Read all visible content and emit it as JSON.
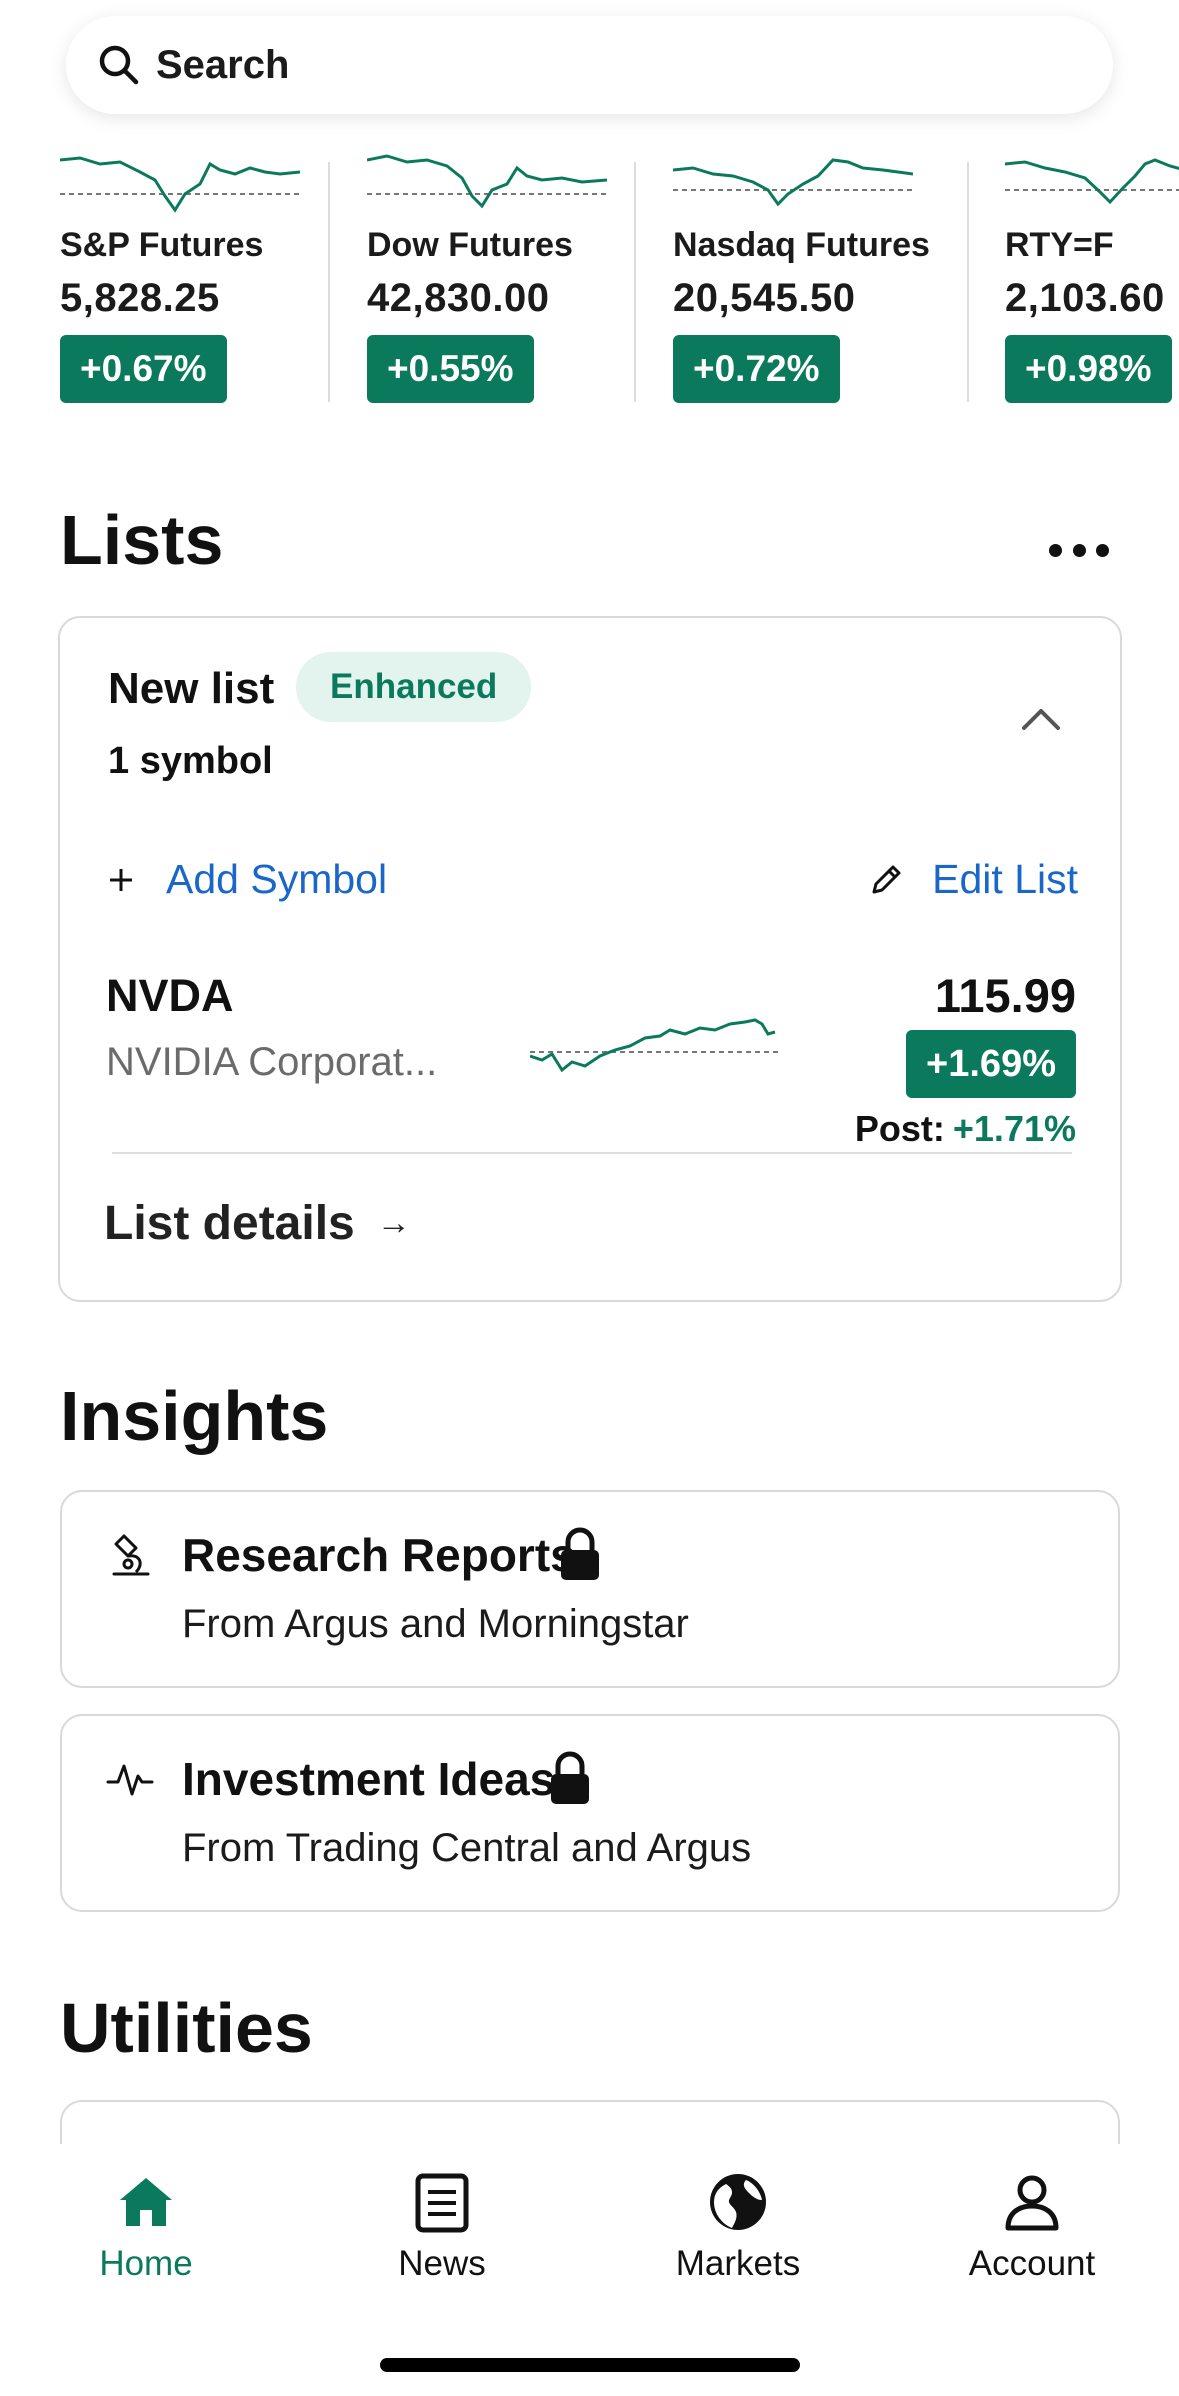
{
  "search": {
    "placeholder": "Search",
    "icon": "search-icon"
  },
  "tickers": [
    {
      "name": "S&P Futures",
      "price": "5,828.25",
      "change": "+0.67%"
    },
    {
      "name": "Dow Futures",
      "price": "42,830.00",
      "change": "+0.55%"
    },
    {
      "name": "Nasdaq Futures",
      "price": "20,545.50",
      "change": "+0.72%"
    },
    {
      "name": "RTY=F",
      "price": "2,103.60",
      "change": "+0.98%"
    }
  ],
  "lists": {
    "heading": "Lists",
    "more_icon": "more-horizontal-icon",
    "card": {
      "title": "New list",
      "badge": "Enhanced",
      "count": "1 symbol",
      "add_symbol": "Add Symbol",
      "edit_list": "Edit List",
      "item": {
        "symbol": "NVDA",
        "name": "NVIDIA Corporat...",
        "price": "115.99",
        "change": "+1.69%",
        "post_label": "Post:",
        "post_change": "+1.71%"
      },
      "details": "List details",
      "details_arrow": "→"
    }
  },
  "insights": {
    "heading": "Insights",
    "items": [
      {
        "title": "Research Reports",
        "subtitle": "From Argus and Morningstar",
        "icon": "microscope-icon"
      },
      {
        "title": "Investment Ideas",
        "subtitle": "From Trading Central and Argus",
        "icon": "pulse-icon"
      }
    ]
  },
  "utilities": {
    "heading": "Utilities"
  },
  "nav": [
    {
      "label": "Home",
      "icon": "home-icon",
      "active": true
    },
    {
      "label": "News",
      "icon": "news-icon",
      "active": false
    },
    {
      "label": "Markets",
      "icon": "globe-icon",
      "active": false
    },
    {
      "label": "Account",
      "icon": "account-icon",
      "active": false
    }
  ],
  "colors": {
    "accent": "#0b7a5c",
    "link": "#1a66c9",
    "badge_bg": "#e3f3ee"
  }
}
